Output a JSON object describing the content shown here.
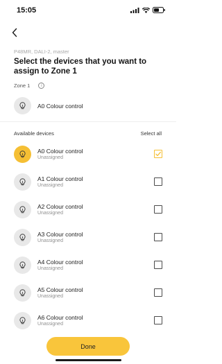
{
  "status_bar": {
    "time": "15:05"
  },
  "header": {
    "subtitle": "P48MR, DALI-2, master",
    "title": "Select the devices that you want to assign to Zone 1"
  },
  "zone": {
    "label": "Zone 1",
    "info_glyph": "i",
    "device": {
      "name": "A0 Colour control",
      "icon": "bulb-icon"
    }
  },
  "available": {
    "label": "Available devices",
    "select_all": "Select all",
    "devices": [
      {
        "name": "A0 Colour control",
        "status": "Unassigned",
        "checked": true,
        "icon": "bulb-icon"
      },
      {
        "name": "A1 Colour control",
        "status": "Unassigned",
        "checked": false,
        "icon": "bulb-icon"
      },
      {
        "name": "A2 Colour control",
        "status": "Unassigned",
        "checked": false,
        "icon": "bulb-icon"
      },
      {
        "name": "A3 Colour control",
        "status": "Unassigned",
        "checked": false,
        "icon": "bulb-icon"
      },
      {
        "name": "A4 Colour control",
        "status": "Unassigned",
        "checked": false,
        "icon": "bulb-icon"
      },
      {
        "name": "A5 Colour control",
        "status": "Unassigned",
        "checked": false,
        "icon": "bulb-icon"
      },
      {
        "name": "A6 Colour control",
        "status": "Unassigned",
        "checked": false,
        "icon": "bulb-icon"
      }
    ]
  },
  "footer": {
    "done_label": "Done"
  },
  "colors": {
    "accent": "#f9c53b",
    "icon_bg": "#e8e8e8"
  }
}
